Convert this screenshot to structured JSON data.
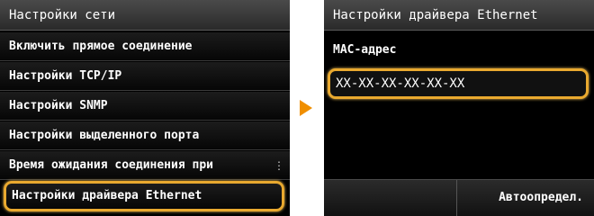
{
  "left_screen": {
    "title": "Настройки сети",
    "items": [
      {
        "label": "Включить прямое соединение"
      },
      {
        "label": "Настройки TCP/IP"
      },
      {
        "label": "Настройки SNMP"
      },
      {
        "label": "Настройки выделенного порта"
      },
      {
        "label": "Время ожидания соединения при"
      },
      {
        "label": "Настройки драйвера Ethernet"
      }
    ],
    "scroll_indicator": "⋮"
  },
  "right_screen": {
    "title": "Настройки драйвера Ethernet",
    "mac_label": "MAC-адрес",
    "mac_value": "XX-XX-XX-XX-XX-XX",
    "auto_button_label": "Автоопредел."
  },
  "colors": {
    "highlight": "#e9a92f",
    "arrow": "#f08f00"
  },
  "icons": {
    "transition": "right-arrow-icon"
  }
}
